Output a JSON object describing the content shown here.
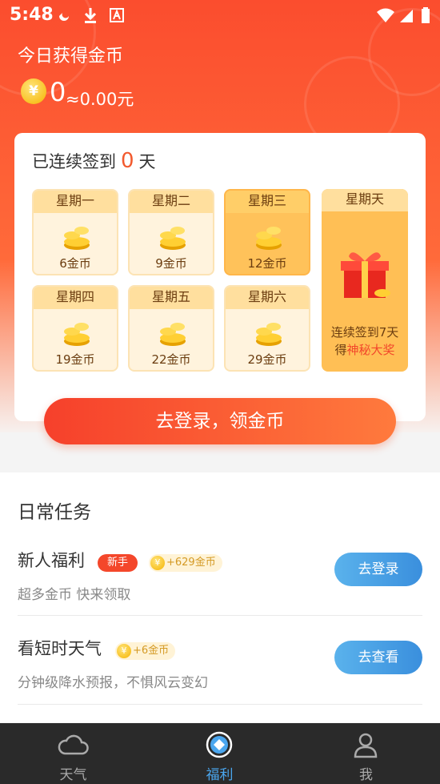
{
  "status_bar": {
    "time": "5:48"
  },
  "header": {
    "today_label": "今日获得金币",
    "coin_symbol": "¥",
    "coins": "0",
    "cash": "≈0.00元"
  },
  "signin": {
    "streak_prefix": "已连续签到",
    "streak_days": "0",
    "streak_suffix": "天",
    "days": [
      {
        "label": "星期一",
        "reward": "6金币"
      },
      {
        "label": "星期二",
        "reward": "9金币"
      },
      {
        "label": "星期三",
        "reward": "12金币"
      },
      {
        "label": "星期四",
        "reward": "19金币"
      },
      {
        "label": "星期五",
        "reward": "22金币"
      },
      {
        "label": "星期六",
        "reward": "29金币"
      }
    ],
    "sunday": {
      "label": "星期天",
      "line1": "连续签到7天",
      "line2_prefix": "得",
      "line2_highlight": "神秘大奖"
    },
    "login_cta": "去登录，领金币"
  },
  "tasks": {
    "title": "日常任务",
    "items": [
      {
        "name": "新人福利",
        "badge": "新手",
        "points": "+629金币",
        "desc": "超多金币 快来领取",
        "action": "去登录"
      },
      {
        "name": "看短时天气",
        "points": "+6金币",
        "desc": "分钟级降水预报，不惧风云变幻",
        "action": "去查看"
      }
    ]
  },
  "nav": [
    {
      "label": "天气",
      "icon": "cloud-icon"
    },
    {
      "label": "福利",
      "icon": "welfare-diamond-icon"
    },
    {
      "label": "我",
      "icon": "person-icon"
    }
  ],
  "colors": {
    "brand_red": "#f6402b",
    "accent_blue": "#4aa6ee",
    "gold": "#f5b400"
  }
}
